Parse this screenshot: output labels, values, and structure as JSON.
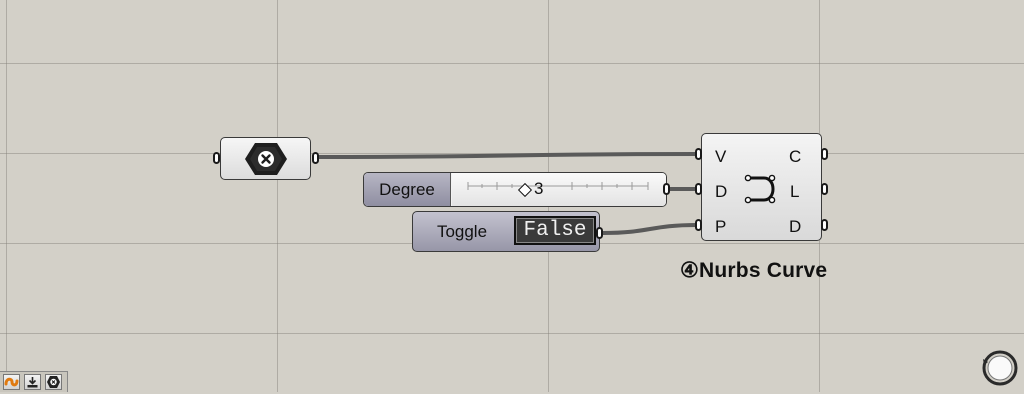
{
  "canvas": {
    "point_param": {
      "icon": "point-param-icon"
    },
    "slider": {
      "name": "Degree",
      "value": "3"
    },
    "toggle": {
      "name": "Toggle",
      "value": "False"
    },
    "nurbs": {
      "inputs": [
        "V",
        "D",
        "P"
      ],
      "outputs": [
        "C",
        "L",
        "D"
      ],
      "title": "④Nurbs Curve",
      "icon": "nurbs-curve-icon"
    }
  },
  "toolbar": {
    "icons": [
      "curve-tool-icon",
      "bake-icon",
      "point-tool-icon"
    ]
  },
  "navigator": {
    "icon": "compass-icon"
  }
}
